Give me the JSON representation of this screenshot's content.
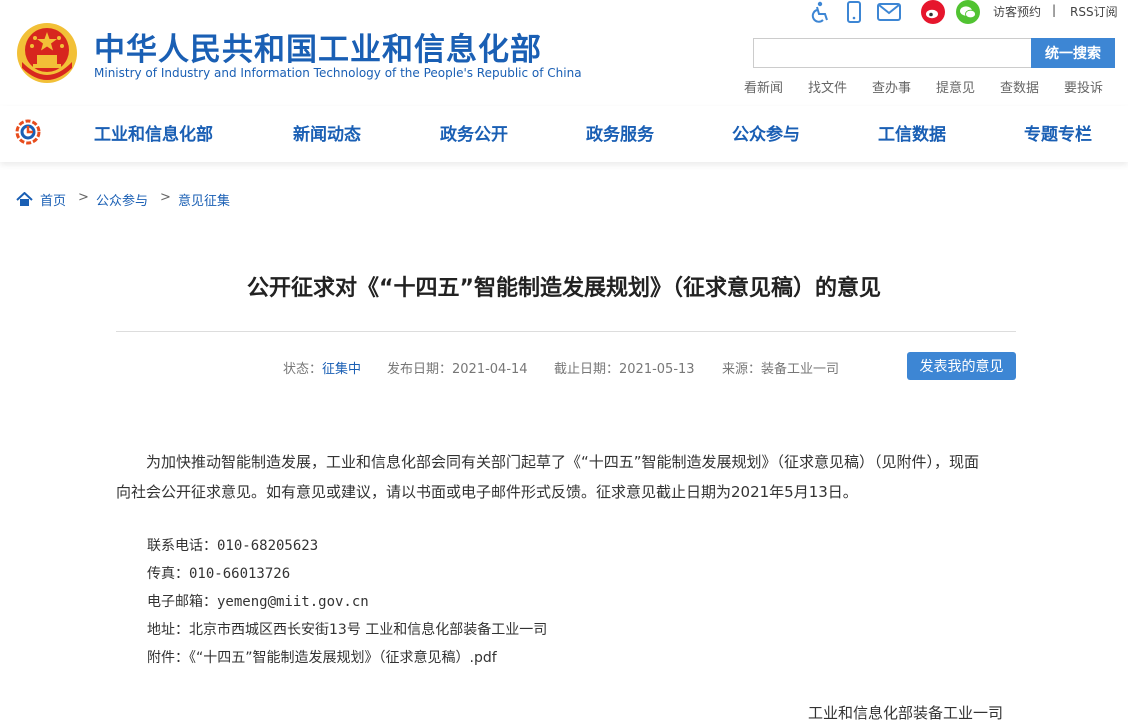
{
  "header": {
    "title_cn": "中华人民共和国工业和信息化部",
    "title_en": "Ministry of Industry and Information Technology of the People's Republic of China",
    "top_links": [
      "访客预约",
      "RSS订阅"
    ],
    "top_separator": "|",
    "search_button": "统一搜索",
    "search_value": "",
    "quick_links": [
      "看新闻",
      "找文件",
      "查办事",
      "提意见",
      "查数据",
      "要投诉"
    ]
  },
  "nav": {
    "items": [
      "工业和信息化部",
      "新闻动态",
      "政务公开",
      "政务服务",
      "公众参与",
      "工信数据",
      "专题专栏"
    ]
  },
  "breadcrumb": {
    "items": [
      "首页",
      "公众参与",
      "意见征集"
    ],
    "separator": ">"
  },
  "article": {
    "title": "公开征求对《“十四五”智能制造发展规划》（征求意见稿）的意见",
    "status_label": "状态：",
    "status_value": "征集中",
    "publish_label": "发布日期：",
    "publish_value": "2021-04-14",
    "deadline_label": "截止日期：",
    "deadline_value": "2021-05-13",
    "source_label": "来源：",
    "source_value": "装备工业一司",
    "opinion_button": "发表我的意见",
    "paragraph": "为加快推动智能制造发展，工业和信息化部会同有关部门起草了《“十四五”智能制造发展规划》（征求意见稿）（见附件），现面向社会公开征求意见。如有意见或建议，请以书面或电子邮件形式反馈。征求意见截止日期为2021年5月13日。",
    "contacts": [
      {
        "label": "联系电话：",
        "value": "010-68205623"
      },
      {
        "label": "传真：",
        "value": "010-66013726"
      },
      {
        "label": "电子邮箱：",
        "value": "yemeng@miit.gov.cn"
      },
      {
        "label": "地址：",
        "value": "北京市西城区西长安街13号 工业和信息化部装备工业一司"
      },
      {
        "label": "附件：",
        "value": "《“十四五”智能制造发展规划》（征求意见稿）.pdf"
      }
    ],
    "signature": "工业和信息化部装备工业一司"
  },
  "colors": {
    "brand_blue": "#1a5fb4",
    "button_blue": "#3d86d4",
    "emblem_red": "#d7261e",
    "emblem_gold": "#f2c037"
  }
}
